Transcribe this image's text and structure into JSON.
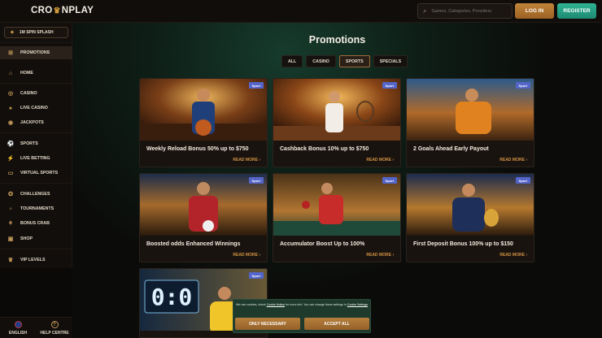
{
  "header": {
    "logo_left": "CRO",
    "logo_right": "NPLAY",
    "search_placeholder": "Games, Categories, Providers",
    "login_label": "LOG IN",
    "register_label": "REGISTER"
  },
  "sidebar": {
    "spin_label": "1M SPIN SPLASH",
    "items": [
      {
        "label": "PROMOTIONS",
        "icon": "gift-icon"
      },
      {
        "label": "HOME",
        "icon": "home-icon"
      },
      {
        "label": "CASINO",
        "icon": "casino-chip-icon"
      },
      {
        "label": "LIVE CASINO",
        "icon": "spade-icon"
      },
      {
        "label": "JACKPOTS",
        "icon": "jackpot-icon"
      },
      {
        "label": "SPORTS",
        "icon": "ball-icon"
      },
      {
        "label": "LIVE BETTING",
        "icon": "live-icon"
      },
      {
        "label": "VIRTUAL SPORTS",
        "icon": "monitor-icon"
      },
      {
        "label": "CHALLENGES",
        "icon": "challenge-icon"
      },
      {
        "label": "TOURNAMENTS",
        "icon": "trophy-icon"
      },
      {
        "label": "BONUS CRAB",
        "icon": "crab-icon"
      },
      {
        "label": "SHOP",
        "icon": "shop-icon"
      },
      {
        "label": "VIP LEVELS",
        "icon": "crown-icon"
      }
    ],
    "language_label": "ENGLISH",
    "help_label": "HELP CENTRE"
  },
  "main": {
    "title": "Promotions",
    "tabs": [
      {
        "label": "ALL"
      },
      {
        "label": "CASINO"
      },
      {
        "label": "SPORTS"
      },
      {
        "label": "SPECIALS"
      }
    ],
    "active_tab": "SPORTS",
    "cards": [
      {
        "badge": "Sport",
        "title": "Weekly Reload Bonus 50% up to $750",
        "more": "READ MORE"
      },
      {
        "badge": "Sport",
        "title": "Cashback Bonus 10% up to $750",
        "more": "READ MORE"
      },
      {
        "badge": "Sport",
        "title": "2 Goals Ahead Early Payout",
        "more": "READ MORE"
      },
      {
        "badge": "Sport",
        "title": "Boosted odds Enhanced Winnings",
        "more": "READ MORE"
      },
      {
        "badge": "Sport",
        "title": "Accumulator Boost Up to 100%",
        "more": "READ MORE"
      },
      {
        "badge": "Sport",
        "title": "First Deposit Bonus 100% up to $150",
        "more": "READ MORE"
      },
      {
        "badge": "Sport",
        "title": "",
        "more": ""
      }
    ],
    "scoreboard": "0:0"
  },
  "cookie": {
    "text_a": "We use cookies, check ",
    "link_notice": "Cookie Notice",
    "text_b": " for more info. You can change these settings in ",
    "link_settings": "Cookie Settings",
    "text_c": ".",
    "only_necessary": "ONLY NECESSARY",
    "accept_all": "ACCEPT ALL"
  },
  "colors": {
    "accent_gold": "#c1843a",
    "register_green": "#2fb394",
    "badge_blue": "#5465c9",
    "read_more": "#d39343"
  }
}
